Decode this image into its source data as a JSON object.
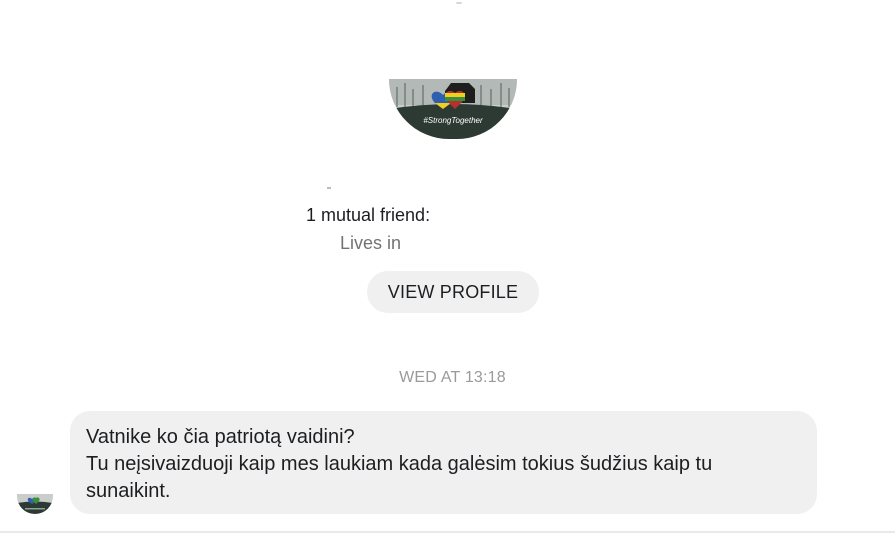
{
  "profile": {
    "avatar_badge_text": "#StrongTogether",
    "mutual_friends": "1 mutual friend:",
    "lives_in": "Lives in",
    "view_profile_label": "VIEW PROFILE"
  },
  "conversation": {
    "timestamp": "WED AT 13:18",
    "message": {
      "lines": [
        "Vatnike ko čia patriotą vaidini?",
        "Tu neįsivaizduoji kaip mes laukiam kada galėsim tokius šudžius kaip tu",
        "sunaikint."
      ]
    }
  },
  "colors": {
    "bubble_bg": "#f0f0f0",
    "button_bg": "#f0f0f0",
    "avatar_dark": "#2d3a33",
    "flag_blue": "#2f5fb0",
    "flag_yellow": "#f2cf1d",
    "flag_green": "#3c8f3c",
    "flag_red": "#b5322c"
  },
  "icons": {
    "profile_avatar": "strongtogether-heart-flags-avatar",
    "sender_avatar": "strongtogether-heart-flags-avatar"
  }
}
